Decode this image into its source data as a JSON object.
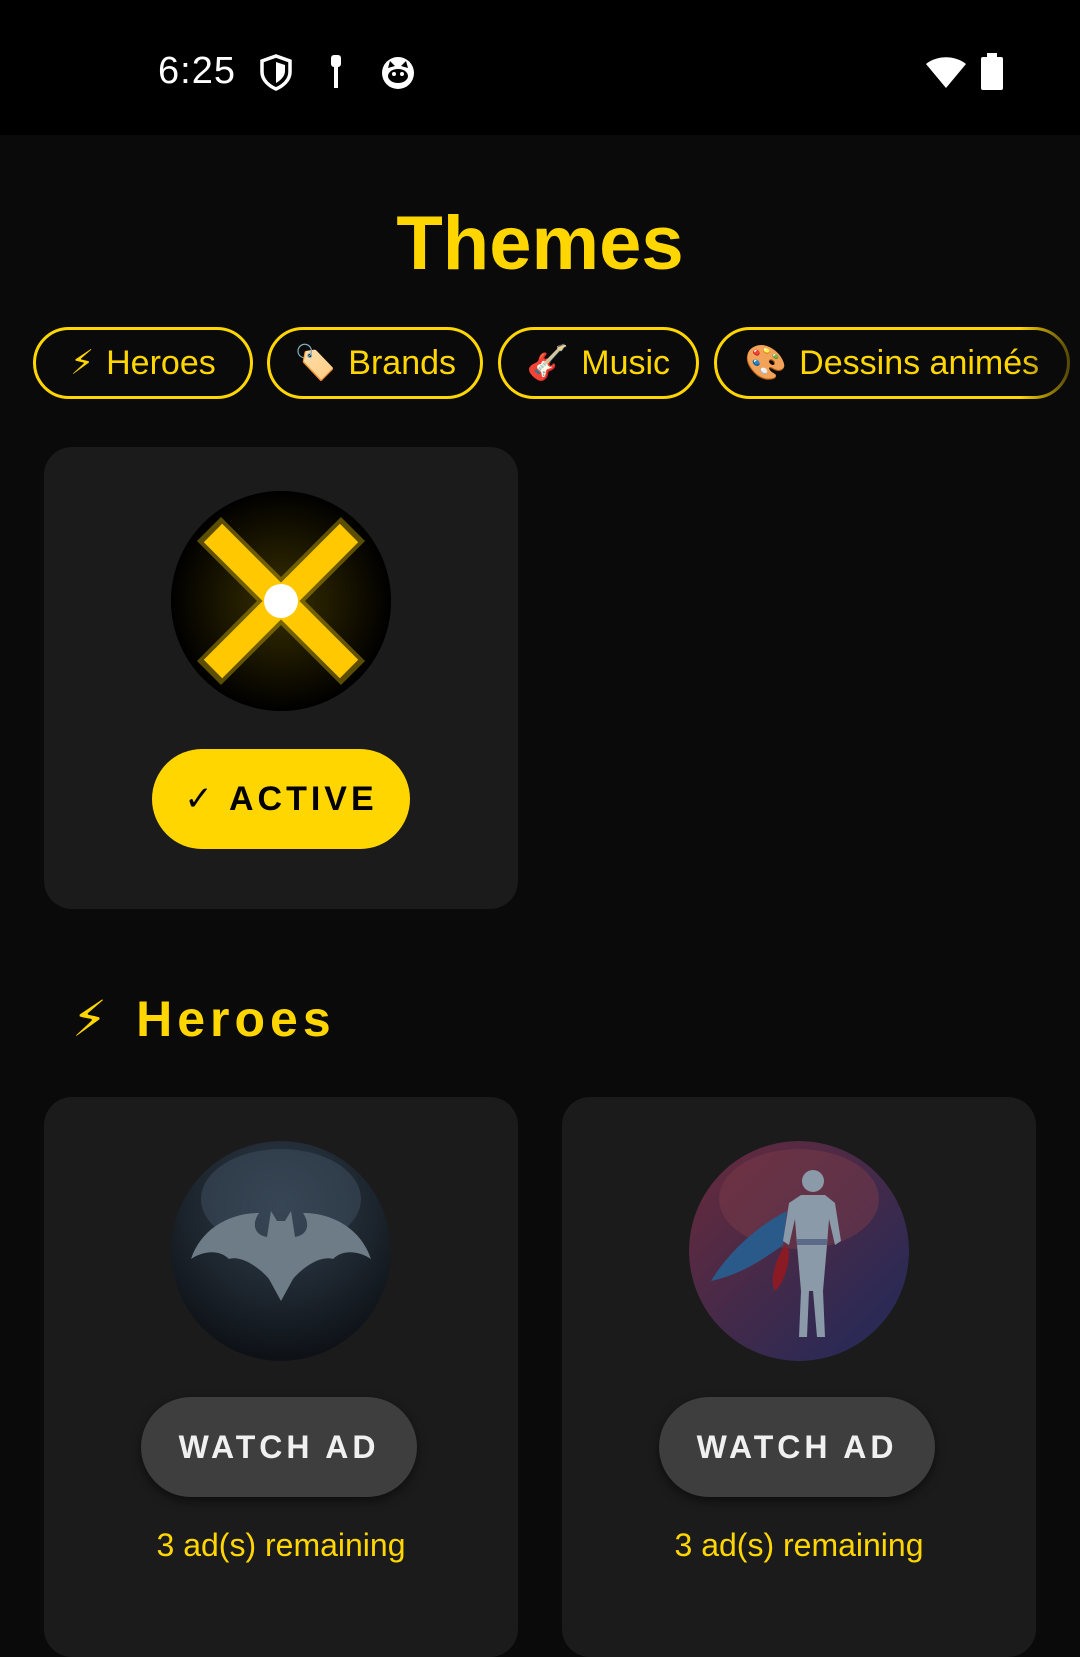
{
  "status_bar": {
    "time": "6:25",
    "icons": [
      "shield-icon",
      "pin-icon",
      "cat-face-icon"
    ],
    "right_icons": [
      "wifi-icon",
      "battery-icon"
    ]
  },
  "page": {
    "title": "Themes"
  },
  "categories": [
    {
      "emoji": "⚡",
      "label": "Heroes"
    },
    {
      "emoji": "🏷️",
      "label": "Brands"
    },
    {
      "emoji": "🎸",
      "label": "Music"
    },
    {
      "emoji": "🎨",
      "label": "Dessins animés"
    }
  ],
  "active_theme": {
    "icon": "x-glow-icon",
    "button_label": "✓ ACTIVE"
  },
  "section": {
    "emoji": "⚡",
    "title": "Heroes"
  },
  "themes": [
    {
      "icon": "bat-icon",
      "button_label": "WATCH AD",
      "remaining": "3 ad(s) remaining"
    },
    {
      "icon": "superhero-icon",
      "button_label": "WATCH AD",
      "remaining": "3 ad(s) remaining"
    }
  ],
  "colors": {
    "accent": "#ffd600",
    "background": "#0a0a0a",
    "card": "#1b1b1b",
    "button_dark": "#3e3e3e"
  }
}
